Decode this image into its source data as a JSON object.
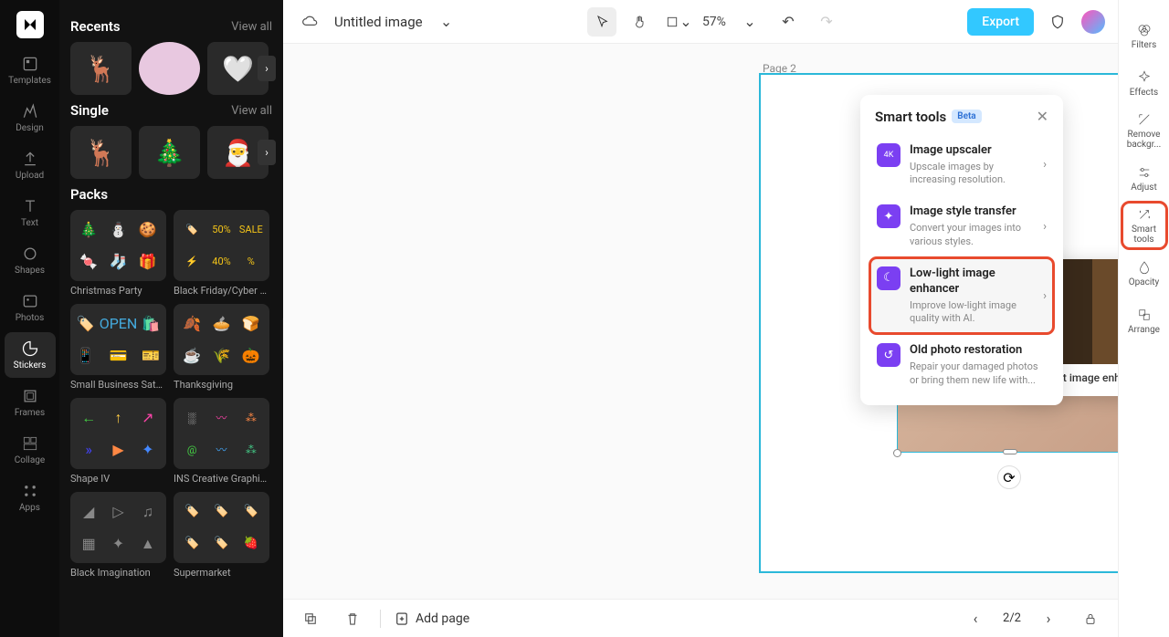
{
  "app": {
    "title": "Untitled image",
    "zoom": "57%"
  },
  "leftnav": [
    {
      "key": "templates",
      "label": "Templates"
    },
    {
      "key": "design",
      "label": "Design"
    },
    {
      "key": "upload",
      "label": "Upload"
    },
    {
      "key": "text",
      "label": "Text"
    },
    {
      "key": "shapes",
      "label": "Shapes"
    },
    {
      "key": "photos",
      "label": "Photos"
    },
    {
      "key": "stickers",
      "label": "Stickers"
    },
    {
      "key": "frames",
      "label": "Frames"
    },
    {
      "key": "collage",
      "label": "Collage"
    },
    {
      "key": "apps",
      "label": "Apps"
    }
  ],
  "stickers": {
    "recents": {
      "title": "Recents",
      "viewall": "View all"
    },
    "single": {
      "title": "Single",
      "viewall": "View all"
    },
    "packs": {
      "title": "Packs"
    },
    "pack_items": [
      {
        "name": "Christmas Party"
      },
      {
        "name": "Black Friday/Cyber M..."
      },
      {
        "name": "Small Business Saturd..."
      },
      {
        "name": "Thanksgiving"
      },
      {
        "name": "Shape IV"
      },
      {
        "name": "INS Creative Graphics"
      },
      {
        "name": "Black Imagination"
      },
      {
        "name": "Supermarket"
      }
    ]
  },
  "canvas": {
    "page_label": "Page 2"
  },
  "export_label": "Export",
  "addpage_label": "Add page",
  "pager": "2/2",
  "rightbar": [
    {
      "key": "filters",
      "label": "Filters"
    },
    {
      "key": "effects",
      "label": "Effects"
    },
    {
      "key": "removebg",
      "label": "Remove backgr..."
    },
    {
      "key": "adjust",
      "label": "Adjust"
    },
    {
      "key": "smarttools",
      "label": "Smart tools"
    },
    {
      "key": "opacity",
      "label": "Opacity"
    },
    {
      "key": "arrange",
      "label": "Arrange"
    }
  ],
  "smarttools": {
    "title": "Smart tools",
    "beta": "Beta",
    "preview_label": "Low-light image enhancer",
    "items": [
      {
        "title": "Image upscaler",
        "desc": "Upscale images by increasing resolution.",
        "glyph": "4K"
      },
      {
        "title": "Image style transfer",
        "desc": "Convert your images into various styles.",
        "glyph": "✦"
      },
      {
        "title": "Low-light image enhancer",
        "desc": "Improve low-light image quality with AI.",
        "glyph": "☾"
      },
      {
        "title": "Old photo restoration",
        "desc": "Repair your damaged photos or bring them new life with...",
        "glyph": "↺"
      }
    ]
  }
}
